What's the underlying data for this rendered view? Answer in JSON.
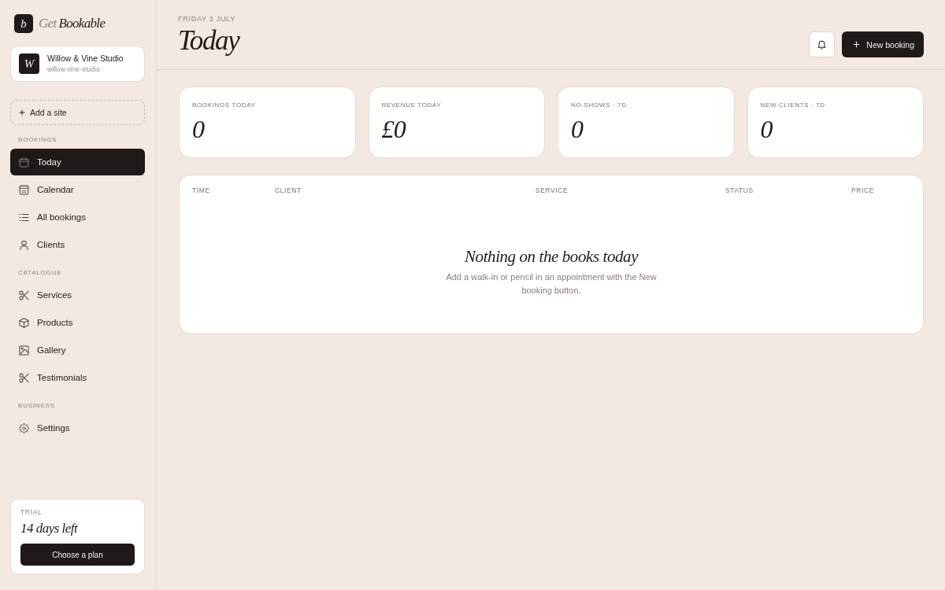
{
  "brand": {
    "mark": "b",
    "prefix": "Get",
    "name": "Bookable"
  },
  "site": {
    "initial": "W",
    "name": "Willow & Vine Studio",
    "slug": "willow-vine-studio"
  },
  "add_site": "Add a site",
  "nav": {
    "sections": [
      {
        "label": "BOOKINGS",
        "items": [
          {
            "label": "Today",
            "selected": true
          },
          {
            "label": "Calendar",
            "selected": false
          },
          {
            "label": "All bookings",
            "selected": false
          },
          {
            "label": "Clients",
            "selected": false
          }
        ]
      },
      {
        "label": "CATALOGUE",
        "items": [
          {
            "label": "Services",
            "selected": false
          },
          {
            "label": "Products",
            "selected": false
          },
          {
            "label": "Gallery",
            "selected": false
          },
          {
            "label": "Testimonials",
            "selected": false
          }
        ]
      },
      {
        "label": "BUSINESS",
        "items": [
          {
            "label": "Settings",
            "selected": false
          }
        ]
      }
    ]
  },
  "trial": {
    "label": "TRIAL",
    "remaining": "14 days left",
    "button": "Choose a plan"
  },
  "header": {
    "date": "FRIDAY 3 JULY",
    "title": "Today",
    "new_booking": "New booking"
  },
  "stats": [
    {
      "label": "BOOKINGS TODAY",
      "value": "0"
    },
    {
      "label": "REVENUE TODAY",
      "value": "£0"
    },
    {
      "label": "NO-SHOWS · 7D",
      "value": "0"
    },
    {
      "label": "NEW CLIENTS · 7D",
      "value": "0"
    }
  ],
  "table": {
    "columns": [
      "TIME",
      "CLIENT",
      "SERVICE",
      "STATUS",
      "PRICE"
    ],
    "empty_state": {
      "title": "Nothing on the books today",
      "message": "Add a walk-in or pencil in an appointment with the New booking button."
    }
  }
}
